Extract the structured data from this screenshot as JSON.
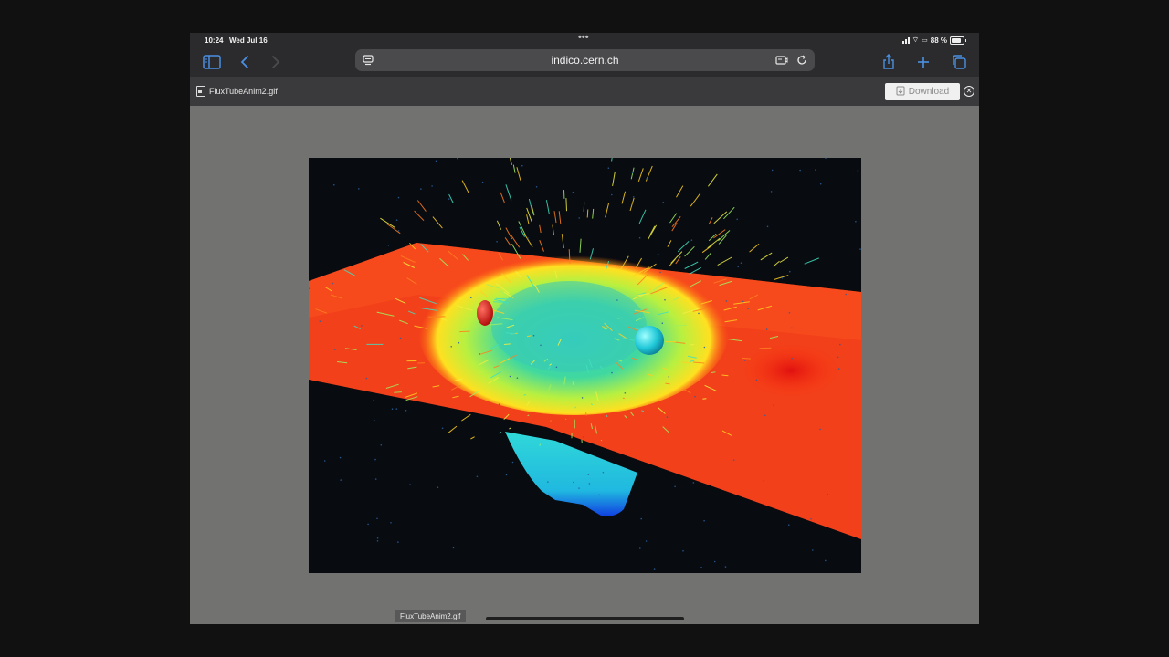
{
  "status_bar": {
    "time": "10:24",
    "date": "Wed Jul 16",
    "battery": "88 %"
  },
  "toolbar": {
    "url": "indico.cern.ch"
  },
  "file_bar": {
    "file_name": "FluxTubeAnim2.gif",
    "download_label": "Download"
  },
  "viewer": {
    "image_label": "FluxTubeAnim2.gif",
    "accent_color": "#4a90e2",
    "background_color": "#727370"
  }
}
